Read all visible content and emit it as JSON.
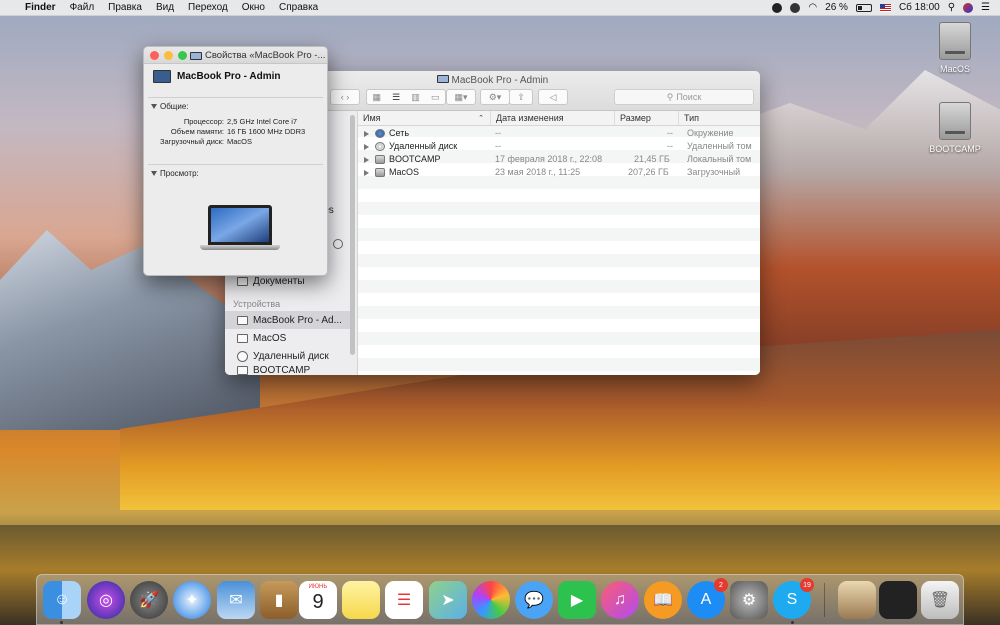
{
  "menubar": {
    "apple": "",
    "app": "Finder",
    "menus": [
      "Файл",
      "Правка",
      "Вид",
      "Переход",
      "Окно",
      "Справка"
    ],
    "battery": "26 %",
    "clock": "Сб 18:00"
  },
  "desktop": {
    "drives": [
      {
        "label": "MacOS"
      },
      {
        "label": "BOOTCAMP"
      }
    ]
  },
  "finder": {
    "title": "MacBook Pro - Admin",
    "search_placeholder": "Поиск",
    "sidebar": {
      "partial_text": "les",
      "documents": "Документы",
      "devices_header": "Устройства",
      "devices": [
        {
          "label": "MacBook Pro - Ad...",
          "selected": true
        },
        {
          "label": "MacOS"
        },
        {
          "label": "Удаленный диск"
        },
        {
          "label": "BOOTCAMP"
        }
      ]
    },
    "columns": {
      "name": "Имя",
      "date": "Дата изменения",
      "size": "Размер",
      "kind": "Тип"
    },
    "rows": [
      {
        "name": "Сеть",
        "date": "--",
        "size": "--",
        "kind": "Окружение",
        "icon": "network-icon"
      },
      {
        "name": "Удаленный диск",
        "date": "--",
        "size": "--",
        "kind": "Удаленный том",
        "icon": "disc-icon"
      },
      {
        "name": "BOOTCAMP",
        "date": "17 февраля 2018 г., 22:08",
        "size": "21,45 ГБ",
        "kind": "Локальный том",
        "icon": "drive-icon"
      },
      {
        "name": "MacOS",
        "date": "23 мая 2018 г., 11:25",
        "size": "207,26 ГБ",
        "kind": "Загрузочный",
        "icon": "drive-icon"
      }
    ]
  },
  "info_window": {
    "title": "Свойства «MacBook Pro -...",
    "name": "MacBook Pro - Admin",
    "general_label": "Общие:",
    "processor_key": "Процессор:",
    "processor_val": "2,5 GHz Intel Core i7",
    "memory_key": "Объем памяти:",
    "memory_val": "16 ГБ 1600 MHz DDR3",
    "startup_key": "Загрузочный диск:",
    "startup_val": "MacOS",
    "preview_label": "Просмотр:"
  },
  "dock": {
    "calendar_month": "ИЮНЬ",
    "calendar_day": "9",
    "appstore_badge": "2",
    "skype_badge": "19"
  },
  "colors": {
    "close": "#fc605c",
    "minimize": "#fdbc40",
    "zoom": "#34c84a",
    "selection": "#d3d3d8"
  }
}
